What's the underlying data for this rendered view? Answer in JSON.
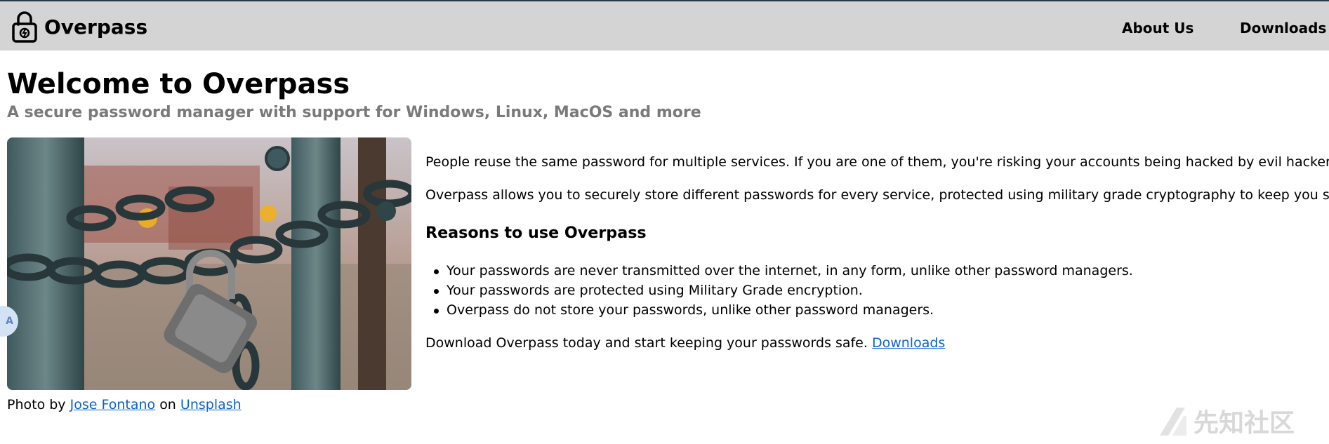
{
  "app": {
    "brand_name": "Overpass",
    "brand_icon": "padlock-icon"
  },
  "nav": {
    "about_label": "About Us",
    "downloads_label": "Downloads"
  },
  "hero": {
    "title": "Welcome to Overpass",
    "subtitle": "A secure password manager with support for Windows, Linux, MacOS and more"
  },
  "photo": {
    "caption_prefix": "Photo by",
    "author": "Jose Fontano",
    "caption_middle": "on",
    "source": "Unsplash"
  },
  "content": {
    "p1": "People reuse the same password for multiple services. If you are one of them, you're risking your accounts being hacked by evil hackers.",
    "p2": "Overpass allows you to securely store different passwords for every service, protected using military grade cryptography to keep you safe.",
    "reasons_heading": "Reasons to use Overpass",
    "reasons": [
      "Your passwords are never transmitted over the internet, in any form, unlike other password managers.",
      "Your passwords are protected using Military Grade encryption.",
      "Overpass do not store your passwords, unlike other password managers."
    ],
    "p3_text": "Download Overpass today and start keeping your passwords safe.",
    "p3_link": "Downloads"
  },
  "overlays": {
    "side_badge": "A",
    "watermark_text": "先知社区"
  },
  "colors": {
    "navbar_bg": "#d4d4d4",
    "link": "#0b63ce",
    "subtitle": "#7a7a7a"
  }
}
